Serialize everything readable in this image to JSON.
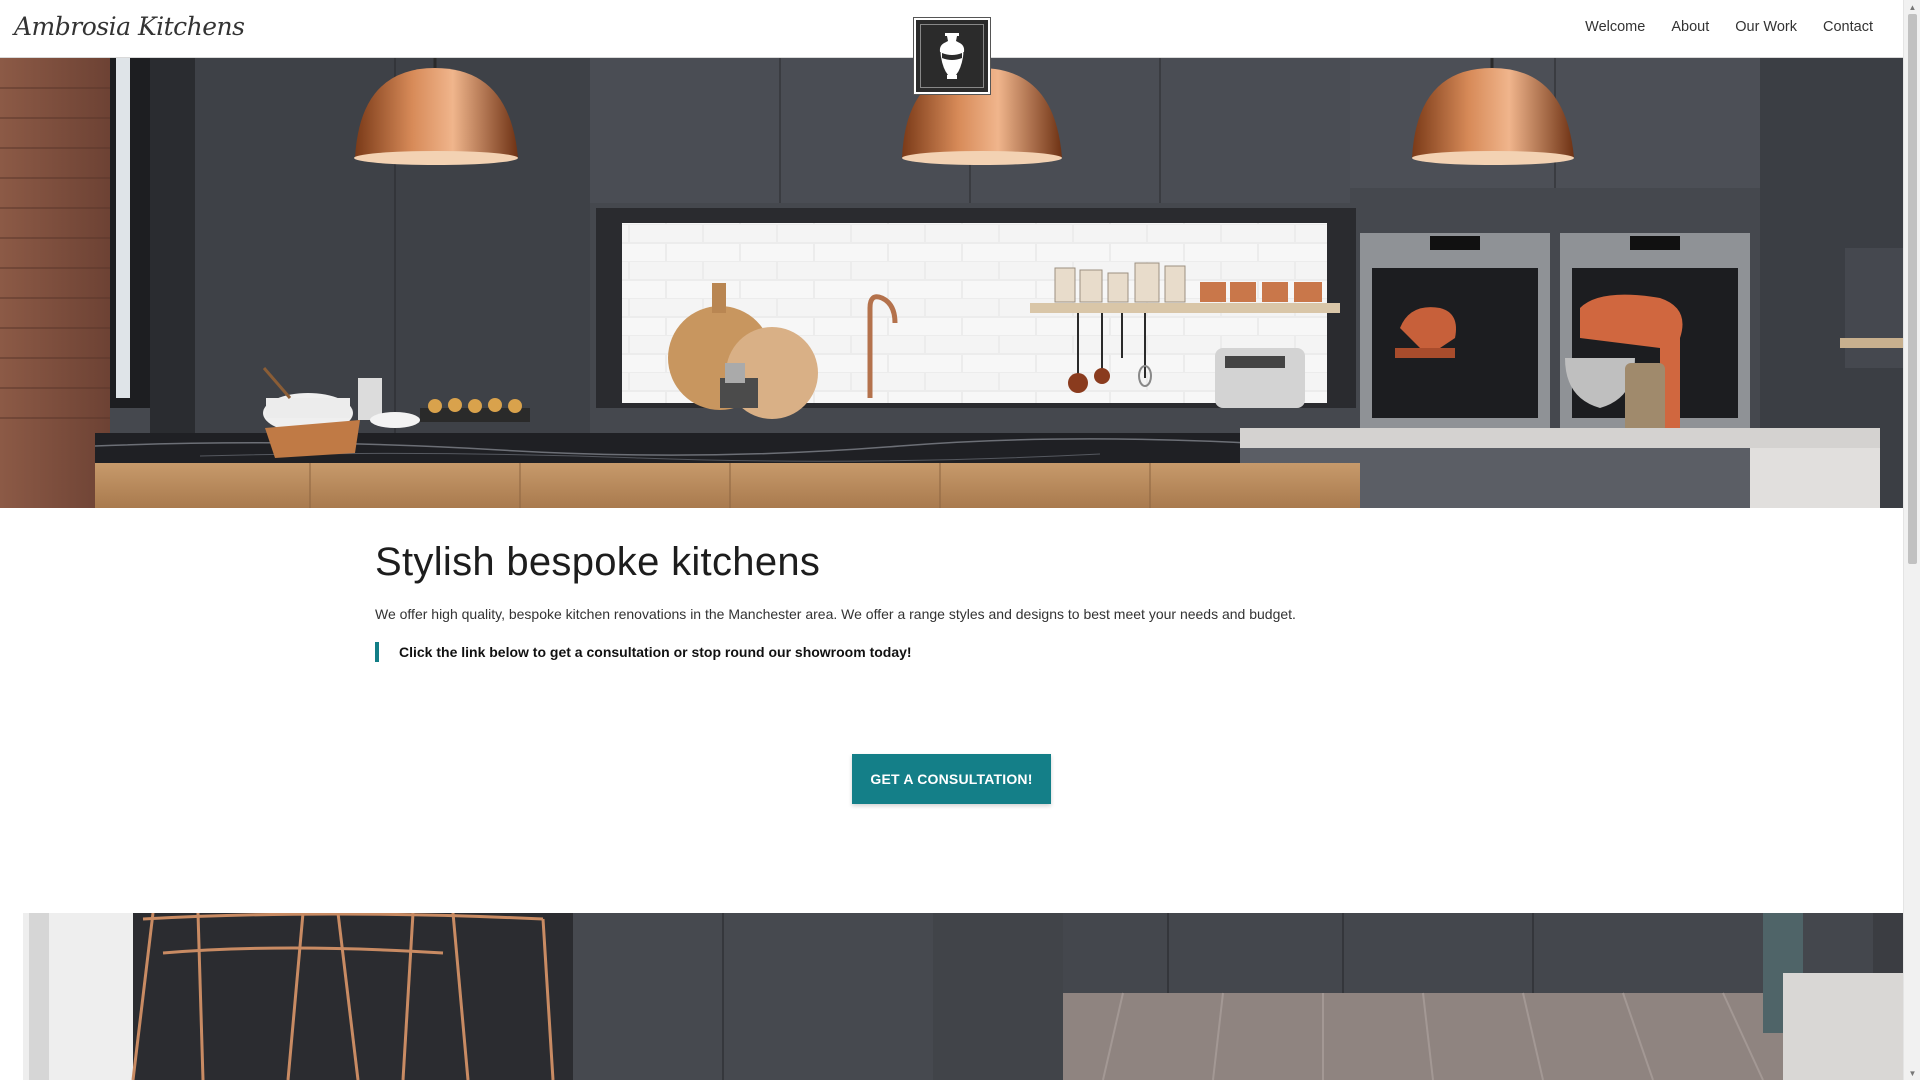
{
  "brand": {
    "name": "Ambrosia Kitchens"
  },
  "logo": {
    "icon": "amphora-icon"
  },
  "nav": {
    "items": [
      {
        "label": "Welcome"
      },
      {
        "label": "About"
      },
      {
        "label": "Our Work"
      },
      {
        "label": "Contact"
      }
    ]
  },
  "hero": {
    "image": "kitchen-hero-photo"
  },
  "main": {
    "title": "Stylish bespoke kitchens",
    "intro": "We offer high quality, bespoke kitchen renovations in the Manchester area. We offer a range styles and designs to best meet your needs and budget.",
    "callout": "Click the link below to get a consultation or stop round our showroom today!",
    "cta_label": "GET A CONSULTATION!"
  },
  "secondary": {
    "image": "kitchen-stools-photo"
  },
  "colors": {
    "accent": "#147f88",
    "header_bg": "#ffffff",
    "logo_bg": "#2b2b2b",
    "cabinet": "#3f4248",
    "copper": "#b5653a"
  }
}
